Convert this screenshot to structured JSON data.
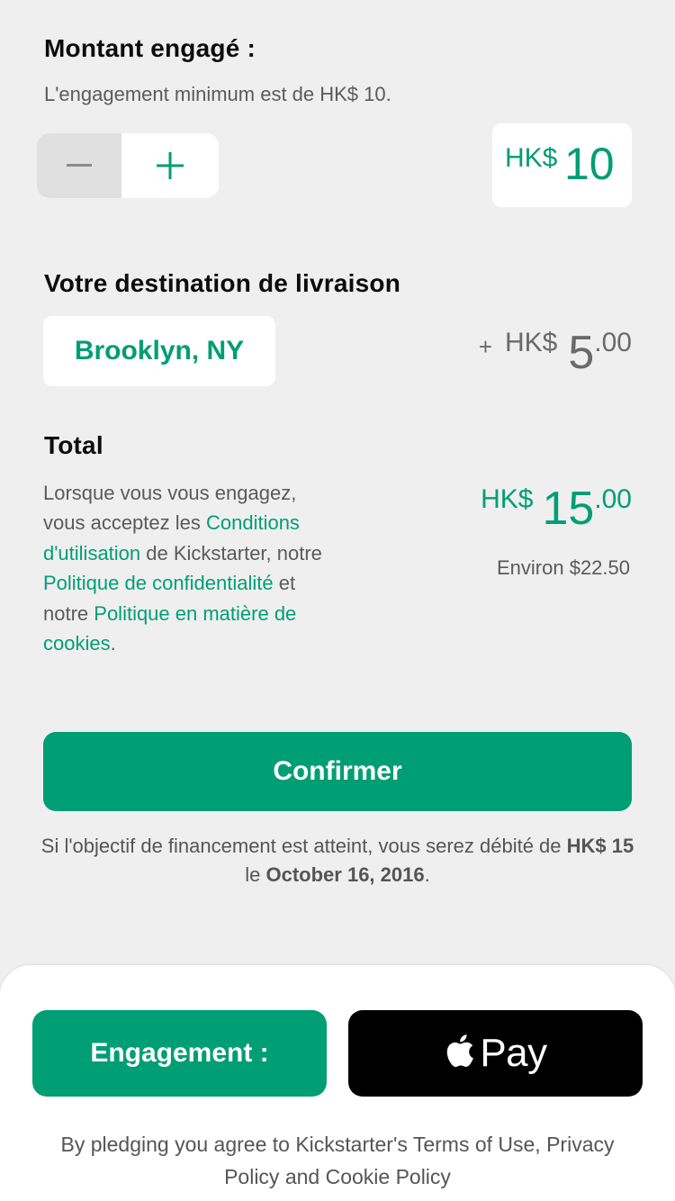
{
  "pledge": {
    "title": "Montant engagé :",
    "minimum_note": "L'engagement minimum est de HK$ 10.",
    "currency": "HK$",
    "amount": "10",
    "decrement_icon": "minus-icon",
    "increment_icon": "plus-icon"
  },
  "shipping": {
    "title": "Votre destination de livraison",
    "destination": "Brooklyn, NY",
    "plus_sign": "+",
    "currency": "HK$",
    "amount_int": "5",
    "amount_dec": ".00"
  },
  "total": {
    "title": "Total",
    "currency": "HK$",
    "amount_int": "15",
    "amount_dec": ".00",
    "approx": "Environ $22.50",
    "legal": {
      "t1": "Lorsque vous vous engagez, vous acceptez les ",
      "link_terms": "Conditions d'utilisation",
      "t2": " de Kickstarter, notre ",
      "link_privacy": "Politique de confidentialité",
      "t3": " et notre ",
      "link_cookies": "Politique en matière de cookies",
      "t4": "."
    }
  },
  "confirm_button": "Confirmer",
  "charge_note": {
    "t1": "Si l'objectif de financement est atteint, vous serez débité de ",
    "amount": "HK$ 15",
    "t2": " le ",
    "date": "October 16, 2016",
    "t3": "."
  },
  "bottom": {
    "pledge_button": "Engagement :",
    "applepay_label": "Pay",
    "applepay_icon": "apple-logo-icon",
    "terms": "By pledging you agree to Kickstarter's Terms of Use, Privacy Policy and Cookie Policy"
  },
  "colors": {
    "accent": "#009e74",
    "background": "#efefef",
    "applepay": "#000000"
  }
}
